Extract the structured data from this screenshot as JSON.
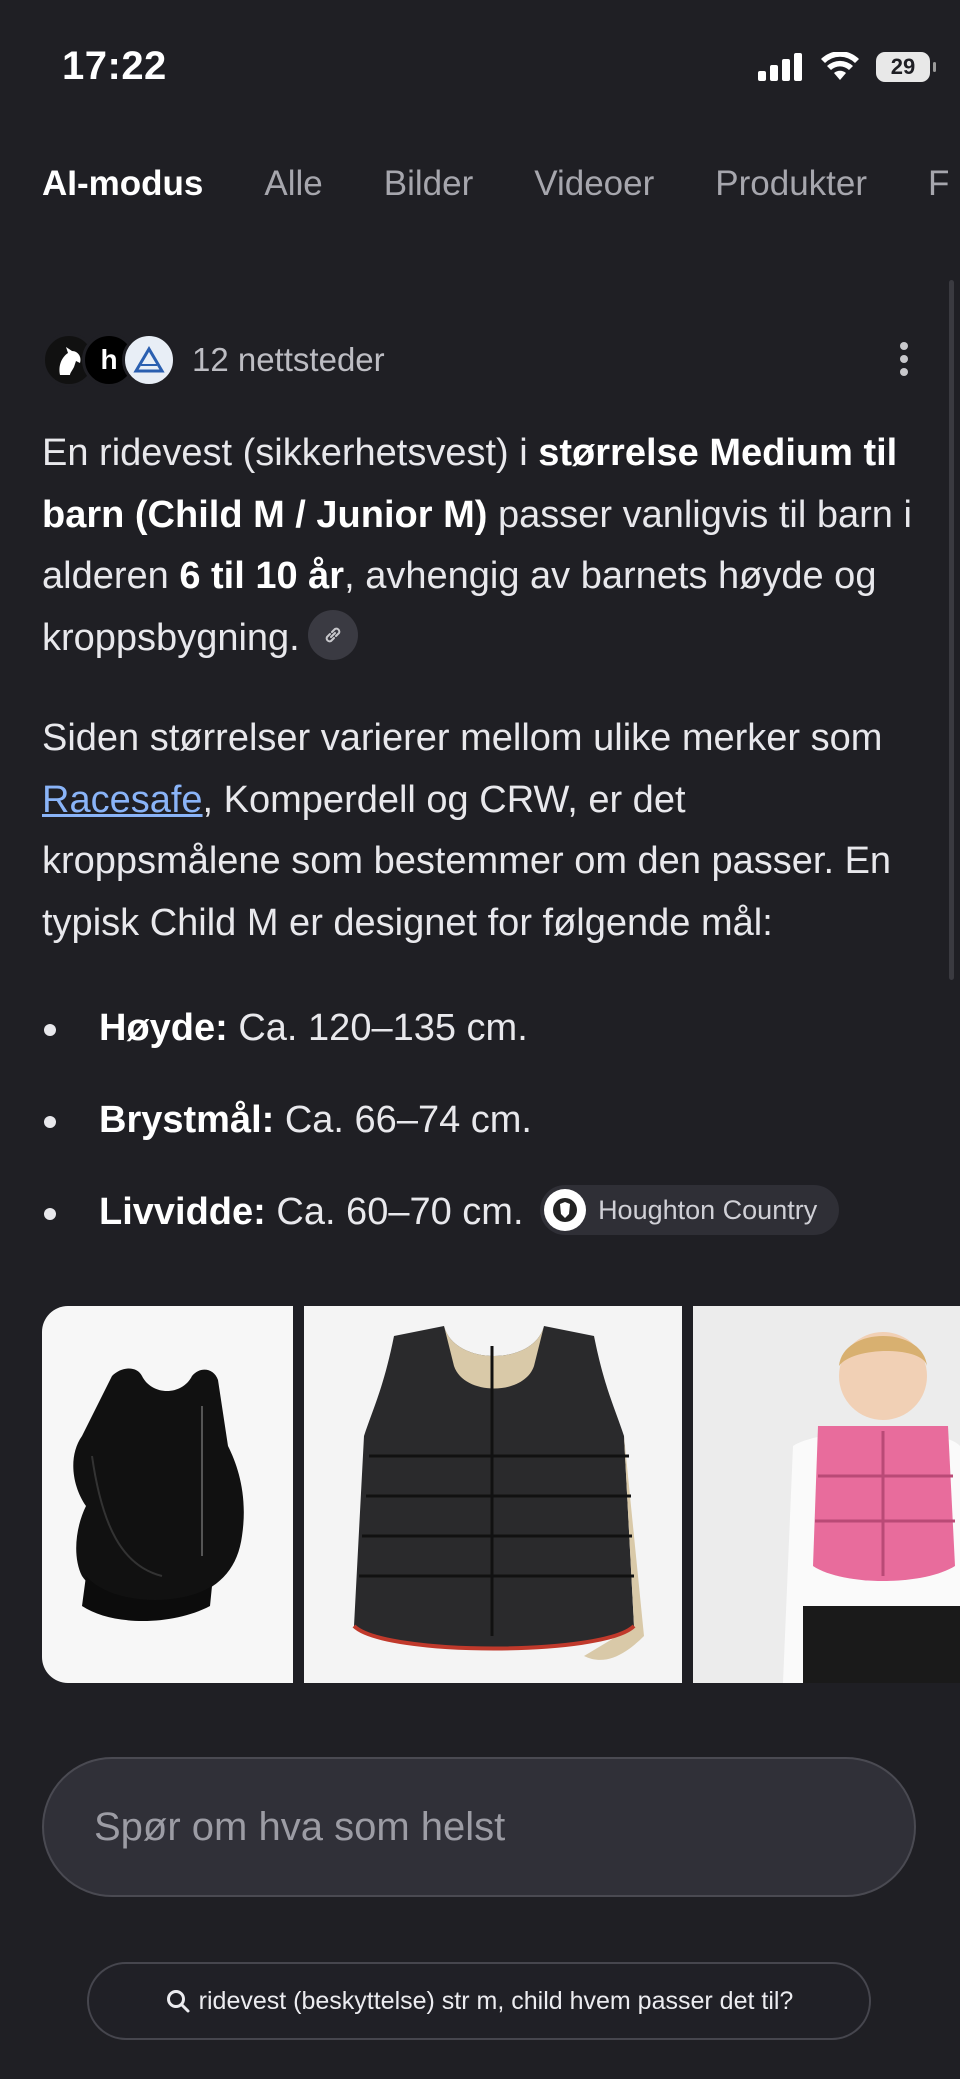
{
  "status_bar": {
    "time": "17:22",
    "battery": "29",
    "icons": [
      "signal-icon",
      "wifi-icon",
      "battery-icon"
    ]
  },
  "tabs": [
    {
      "label": "AI-modus",
      "active": true
    },
    {
      "label": "Alle",
      "active": false
    },
    {
      "label": "Bilder",
      "active": false
    },
    {
      "label": "Videoer",
      "active": false
    },
    {
      "label": "Produkter",
      "active": false
    },
    {
      "label": "F",
      "active": false
    }
  ],
  "sources": {
    "count_label": "12 nettsteder",
    "avatars": [
      "horse-logo",
      "h",
      "triangle-logo"
    ]
  },
  "answer": {
    "p1": {
      "t1": "En ridevest (sikkerhetsvest) i ",
      "b1": "størrelse Medium til barn (Child M / Junior M)",
      "t2": " passer vanligvis til barn i alderen ",
      "b2": "6 til 10 år",
      "t3": ", avhengig av barnets høyde og kroppsbygning."
    },
    "p2": {
      "t1": "Siden størrelser varierer mellom ulike merker som ",
      "link": "Racesafe",
      "t2": ", Komperdell og CRW, er det kroppsmålene som bestemmer om den passer. En typisk Child M er designet for følgende mål:"
    },
    "bullets": [
      {
        "label": "Høyde:",
        "value": " Ca. 120–135 cm."
      },
      {
        "label": "Brystmål:",
        "value": " Ca. 66–74 cm."
      },
      {
        "label": "Livvidde:",
        "value": " Ca. 60–70 cm."
      }
    ],
    "source_chip": "Houghton Country"
  },
  "images": [
    "black-vest-image",
    "racesafe-vest-image",
    "pink-vest-child-image"
  ],
  "ask": {
    "placeholder": "Spør om hva som helst"
  },
  "query_chip": {
    "text": "ridevest (beskyttelse) str m, child hvem passer det til?"
  }
}
